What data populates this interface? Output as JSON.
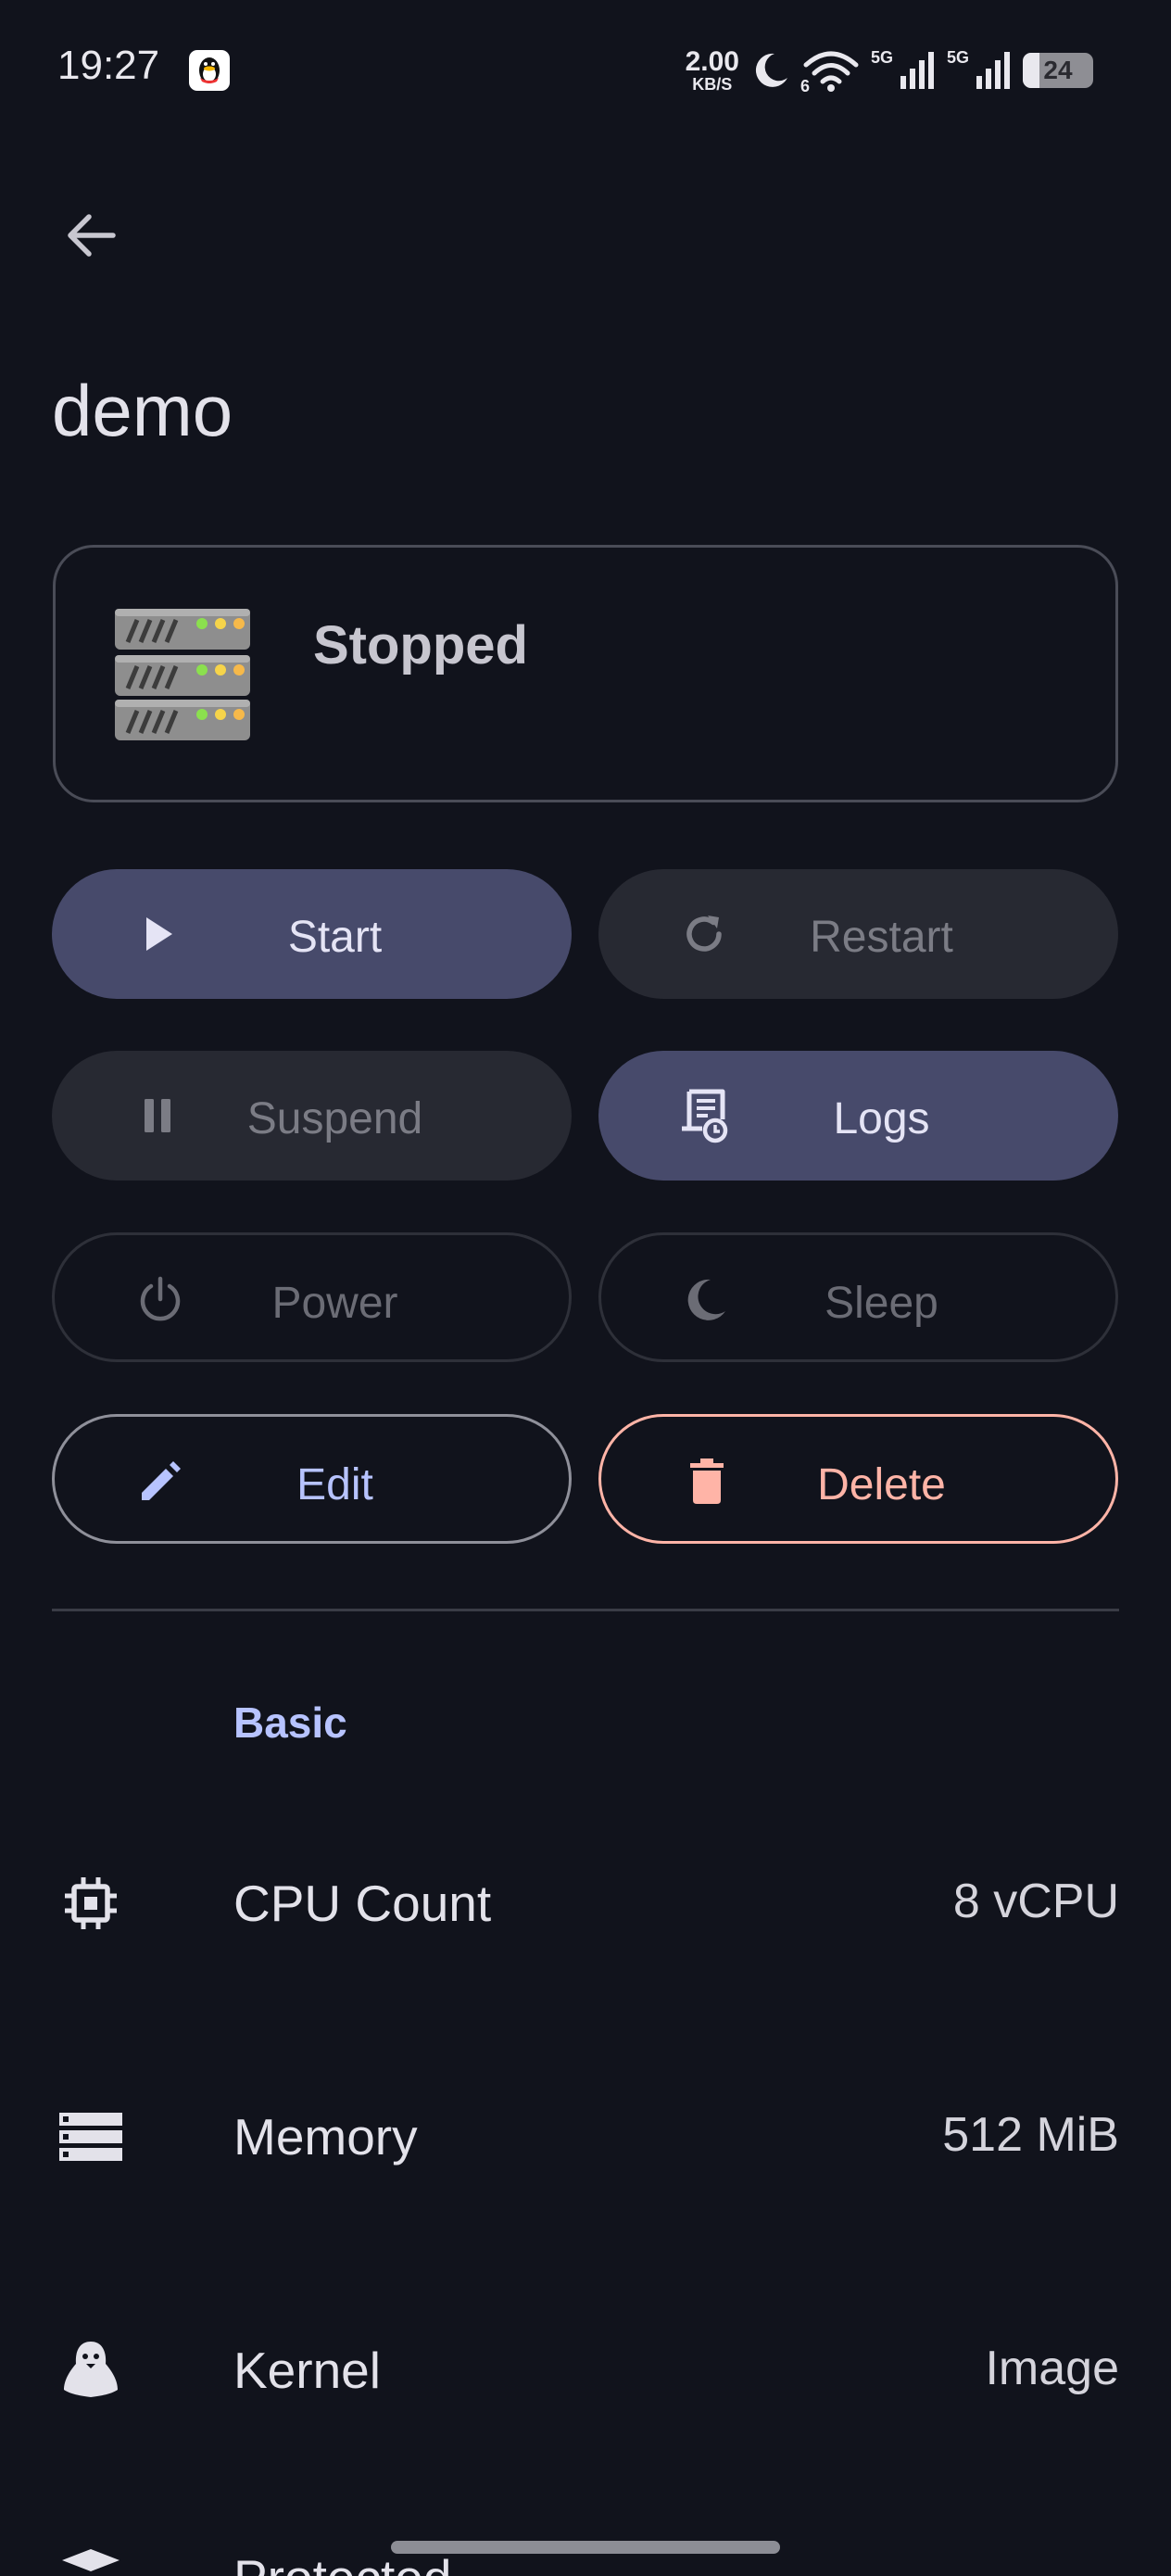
{
  "status_bar": {
    "time": "19:27",
    "net_speed_value": "2.00",
    "net_speed_unit": "KB/S",
    "wifi_sub": "6",
    "signal_1": "5G",
    "signal_2": "5G",
    "battery": "24"
  },
  "header": {
    "title": "demo"
  },
  "status_card": {
    "state": "Stopped",
    "icon": "server-rack-icon"
  },
  "actions": {
    "start": "Start",
    "restart": "Restart",
    "suspend": "Suspend",
    "logs": "Logs",
    "power": "Power",
    "sleep": "Sleep",
    "edit": "Edit",
    "delete": "Delete"
  },
  "basic": {
    "section_title": "Basic",
    "rows": [
      {
        "label": "CPU Count",
        "value": "8 vCPU",
        "icon": "cpu-icon"
      },
      {
        "label": "Memory",
        "value": "512 MiB",
        "icon": "memory-icon"
      },
      {
        "label": "Kernel",
        "value": "Image",
        "icon": "linux-penguin-icon"
      },
      {
        "label": "Protected",
        "value": "",
        "icon": "shield-icon"
      }
    ]
  },
  "colors": {
    "background": "#11131c",
    "primary_container": "#474a6b",
    "accent": "#b7c3ff",
    "danger": "#ffb4a7"
  }
}
